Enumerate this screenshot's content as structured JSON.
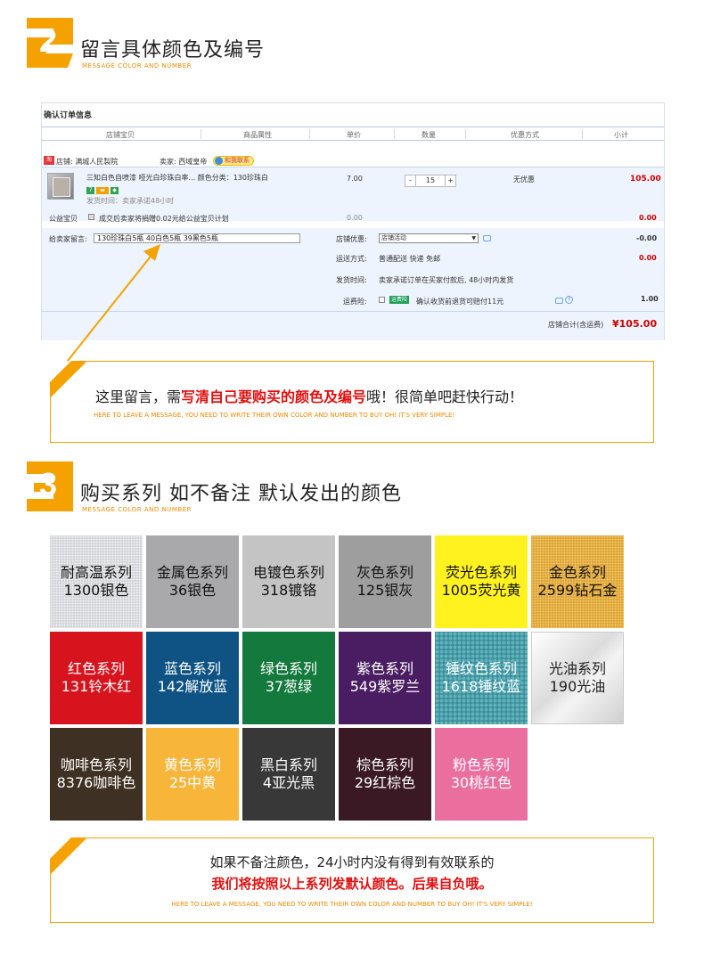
{
  "section2": {
    "number": "2",
    "title": "留言具体颜色及编号",
    "subtitle": "MESSAGE COLOR AND NUMBER"
  },
  "order": {
    "title": "确认订单信息",
    "headers": [
      "店铺宝贝",
      "商品属性",
      "单价",
      "数量",
      "优惠方式",
      "小计"
    ],
    "shop_label": "店铺: 满城人民製院",
    "seller_label": "卖家: 西域皇帝",
    "contact_label": "和我联系",
    "item_title": "三知白色自喷漆 哑光白珍珠白率... 颜色分类：130珍珠白",
    "item_ship": "发货时间：卖家承诺48小时",
    "unit_price": "7.00",
    "quantity": "15",
    "discount": "无优惠",
    "subtotal": "105.00",
    "charity_label": "公益宝贝",
    "charity_text": "成交后卖家将捐赠0.02元给公益宝贝计划",
    "charity_price": "0.00",
    "charity_total": "0.00",
    "message_label": "给卖家留言:",
    "message_value": "130珍珠白5瓶   40白色5瓶   39黑色5瓶",
    "promo_label": "店铺优惠:",
    "promo_select": "店铺活动",
    "promo_value": "-0.00",
    "ship_label": "运送方式:",
    "ship_value": "普通配送 快递 免邮",
    "ship_price": "0.00",
    "delivery_label": "发货时间:",
    "delivery_value": "卖家承诺订单在买家付款后, 48小时内发货",
    "insurance_label": "运费险:",
    "insurance_tag": "运费险",
    "insurance_text": "确认收货前退货可赔付11元",
    "insurance_price": "1.00",
    "total_label": "店铺合计(含运费)",
    "total_value": "¥105.00"
  },
  "notice1": {
    "text_before": "这里留言，需",
    "text_highlight": "写清自己要购买的颜色及编号",
    "text_after": "哦！很简单吧赶快行动！",
    "english": "HERE TO LEAVE A MESSAGE, YOU NEED TO WRITE THEIR OWN COLOR AND NUMBER TO BUY OH! IT'S VERY SIMPLE!"
  },
  "section3": {
    "number": "3",
    "title": "购买系列 如不备注 默认发出的颜色",
    "subtitle": "MESSAGE COLOR AND NUMBER"
  },
  "swatches": [
    {
      "line1": "耐高温系列",
      "line2": "1300银色",
      "bg": "#d4d5d8",
      "fg": "#111111"
    },
    {
      "line1": "金属色系列",
      "line2": "36银色",
      "bg": "#a9a9ab",
      "fg": "#111111"
    },
    {
      "line1": "电镀色系列",
      "line2": "318镀铬",
      "bg": "#c4c4c4",
      "fg": "#111111"
    },
    {
      "line1": "灰色系列",
      "line2": "125银灰",
      "bg": "#9e9e9e",
      "fg": "#111111"
    },
    {
      "line1": "荧光色系列",
      "line2": "1005荧光黄",
      "bg": "#fff21f",
      "fg": "#111111"
    },
    {
      "line1": "金色系列",
      "line2": "2599钻石金",
      "bg": "#dda53c",
      "fg": "#111111"
    },
    {
      "line1": "红色系列",
      "line2": "131铃木红",
      "bg": "#d7131d",
      "fg": "#ffffff"
    },
    {
      "line1": "蓝色系列",
      "line2": "142解放蓝",
      "bg": "#0e5384",
      "fg": "#ffffff"
    },
    {
      "line1": "绿色系列",
      "line2": "37葱绿",
      "bg": "#13793d",
      "fg": "#ffffff"
    },
    {
      "line1": "紫色系列",
      "line2": "549紫罗兰",
      "bg": "#4a1d62",
      "fg": "#ffffff"
    },
    {
      "line1": "锤纹色系列",
      "line2": "1618锤纹蓝",
      "bg": "#3c8d97",
      "fg": "#ffffff"
    },
    {
      "line1": "光油系列",
      "line2": "190光油",
      "bg": "#e6e6e6",
      "fg": "#222222"
    },
    {
      "line1": "咖啡色系列",
      "line2": "8376咖啡色",
      "bg": "#3e3022",
      "fg": "#ffffff"
    },
    {
      "line1": "黄色系列",
      "line2": "25中黄",
      "bg": "#f7b53a",
      "fg": "#ffffff"
    },
    {
      "line1": "黑白系列",
      "line2": "4亚光黑",
      "bg": "#383839",
      "fg": "#ffffff"
    },
    {
      "line1": "棕色系列",
      "line2": "29红棕色",
      "bg": "#3a1924",
      "fg": "#ffffff"
    },
    {
      "line1": "粉色系列",
      "line2": "30桃红色",
      "bg": "#ea6f9f",
      "fg": "#ffffff"
    }
  ],
  "notice2": {
    "line1": "如果不备注颜色，24小时内没有得到有效联系的",
    "line2": "我们将按照以上系列发默认颜色。后果自负哦。",
    "english": "HERE TO LEAVE A MESSAGE, YOU NEED TO WRITE THEIR OWN COLOR AND NUMBER TO BUY OH! IT'S VERY SIMPLE!"
  },
  "colors": {
    "accent": "#f5a200",
    "highlight": "#e01010",
    "price": "#cc0000"
  }
}
